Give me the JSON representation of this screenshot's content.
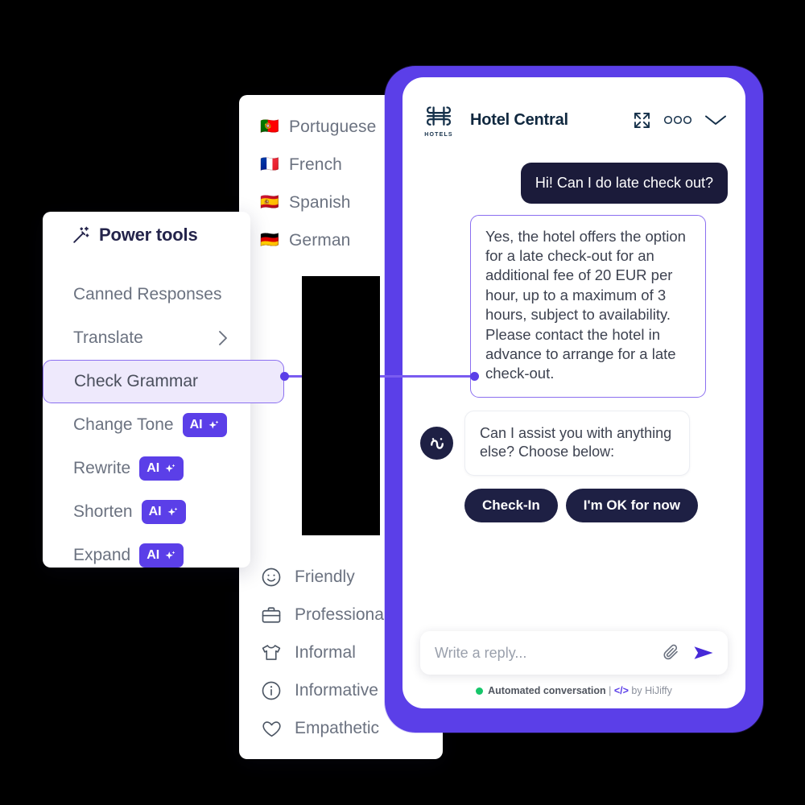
{
  "power_tools": {
    "title": "Power tools",
    "title_icon": "magic-wand-icon",
    "items": [
      {
        "label": "Canned Responses",
        "ai": false,
        "chevron": false,
        "selected": false
      },
      {
        "label": "Translate",
        "ai": false,
        "chevron": true,
        "selected": false
      },
      {
        "label": "Check Grammar",
        "ai": false,
        "chevron": false,
        "selected": true
      },
      {
        "label": "Change Tone",
        "ai": true,
        "chevron": false,
        "selected": false
      },
      {
        "label": "Rewrite",
        "ai": true,
        "chevron": false,
        "selected": false
      },
      {
        "label": "Shorten",
        "ai": true,
        "chevron": false,
        "selected": false
      },
      {
        "label": "Expand",
        "ai": true,
        "chevron": false,
        "selected": false
      }
    ],
    "ai_badge_label": "AI",
    "accent_color": "#5b3fe8",
    "selected_bg": "#eee9fc"
  },
  "languages": [
    {
      "label": "Portuguese",
      "flag": "🇵🇹"
    },
    {
      "label": "French",
      "flag": "🇫🇷"
    },
    {
      "label": "Spanish",
      "flag": "🇪🇸"
    },
    {
      "label": "German",
      "flag": "🇩🇪"
    }
  ],
  "tones": [
    {
      "label": "Friendly",
      "icon": "smiley-icon"
    },
    {
      "label": "Professional",
      "icon": "briefcase-icon"
    },
    {
      "label": "Informal",
      "icon": "tshirt-icon"
    },
    {
      "label": "Informative",
      "icon": "info-circle-icon"
    },
    {
      "label": "Empathetic",
      "icon": "heart-icon"
    }
  ],
  "chat": {
    "brand_name": "Hotel Central",
    "logo_word": "HOTELS",
    "header_actions": [
      {
        "name": "expand-icon"
      },
      {
        "name": "more-options-icon"
      },
      {
        "name": "chevron-down-icon"
      }
    ],
    "messages": [
      {
        "type": "outgoing",
        "text": "Hi! Can I do late check out?"
      },
      {
        "type": "quoted",
        "text": "Yes, the hotel offers the option for a late check-out for an additional fee of 20 EUR per hour, up to a maximum of 3 hours, subject to availability. Please contact the hotel in advance to arrange for a late check-out."
      },
      {
        "type": "incoming",
        "text": "Can I assist you with anything else? Choose below:"
      }
    ],
    "quick_replies": [
      "Check-In",
      "I'm OK for now"
    ],
    "composer": {
      "placeholder": "Write a reply...",
      "attach_icon": "paperclip-icon",
      "send_icon": "send-icon"
    },
    "footer": {
      "status": "Automated conversation",
      "separator": "|",
      "code_icon": "</>",
      "credit": "by HiJiffy",
      "status_dot_color": "#16c66a"
    },
    "frame_color": "#5b3fe8"
  }
}
